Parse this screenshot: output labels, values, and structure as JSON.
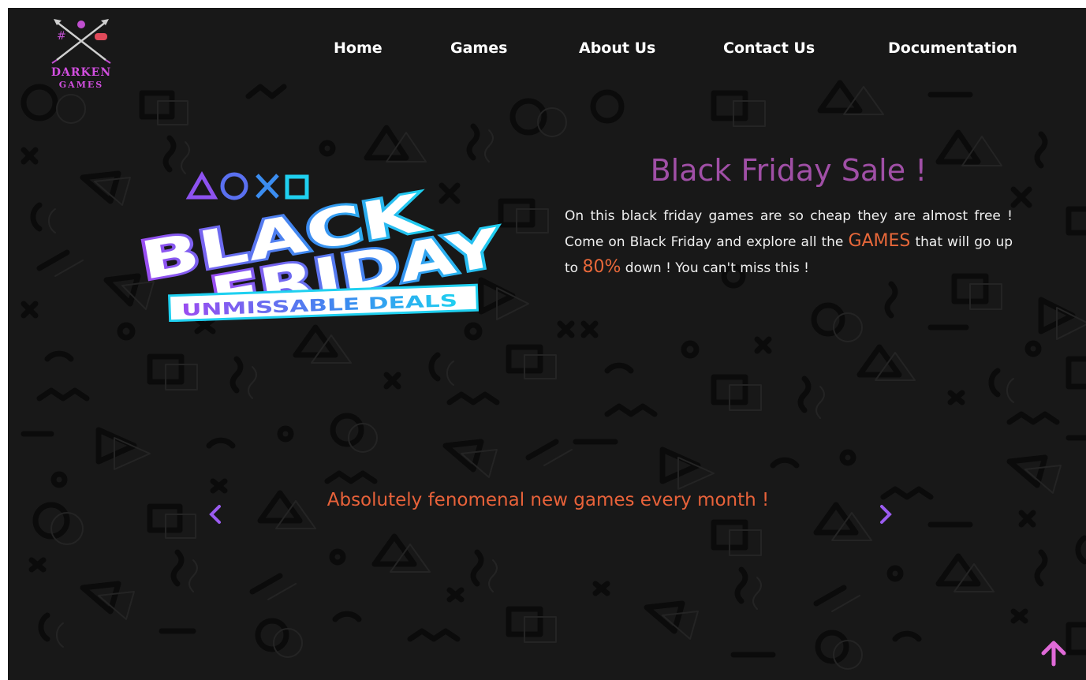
{
  "logo": {
    "line1": "DARKEN",
    "line2": "GAMES"
  },
  "nav": [
    {
      "label": "Home"
    },
    {
      "label": "Games"
    },
    {
      "label": "About Us"
    },
    {
      "label": "Contact Us"
    },
    {
      "label": "Documentation"
    }
  ],
  "hero_graphic": {
    "word1": "BLACK",
    "word2": "FRIDAY",
    "banner": "UNMISSABLE DEALS"
  },
  "sale": {
    "title": "Black Friday Sale !",
    "text_part1": "On this black friday games are so cheap they are almost free ! Come on Black Friday and explore all the ",
    "highlight1": "GAMES",
    "text_part2": " that will go up to ",
    "highlight2": "80%",
    "text_part3": " down ! You can't miss this !"
  },
  "carousel": {
    "text": "Absolutely fenomenal new games every month !",
    "prev_icon": "chevron-left-icon",
    "next_icon": "chevron-right-icon"
  },
  "back_to_top_icon": "arrow-up-icon",
  "colors": {
    "background": "#181818",
    "title_purple": "#a04fa6",
    "accent_orange": "#e8683a",
    "arrow_purple": "#9b5cf0",
    "back_top_pink": "#e06ad8"
  }
}
